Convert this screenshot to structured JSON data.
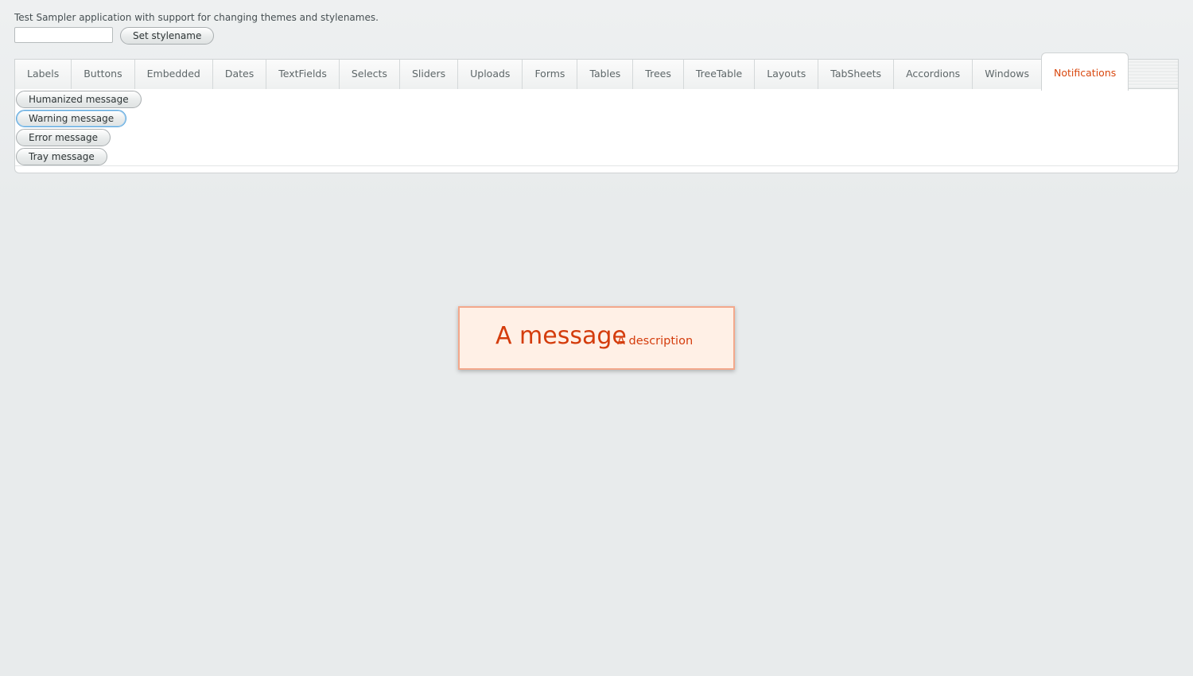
{
  "app": {
    "intro_text": "Test Sampler application with support for changing themes and stylenames.",
    "stylename_input_value": "",
    "set_stylename_label": "Set stylename"
  },
  "tabs": [
    {
      "label": "Labels",
      "selected": false
    },
    {
      "label": "Buttons",
      "selected": false
    },
    {
      "label": "Embedded",
      "selected": false
    },
    {
      "label": "Dates",
      "selected": false
    },
    {
      "label": "TextFields",
      "selected": false
    },
    {
      "label": "Selects",
      "selected": false
    },
    {
      "label": "Sliders",
      "selected": false
    },
    {
      "label": "Uploads",
      "selected": false
    },
    {
      "label": "Forms",
      "selected": false
    },
    {
      "label": "Tables",
      "selected": false
    },
    {
      "label": "Trees",
      "selected": false
    },
    {
      "label": "TreeTable",
      "selected": false
    },
    {
      "label": "Layouts",
      "selected": false
    },
    {
      "label": "TabSheets",
      "selected": false
    },
    {
      "label": "Accordions",
      "selected": false
    },
    {
      "label": "Windows",
      "selected": false
    },
    {
      "label": "Notifications",
      "selected": true
    }
  ],
  "notifications_tab": {
    "buttons": [
      {
        "label": "Humanized message",
        "focused": false
      },
      {
        "label": "Warning message",
        "focused": true
      },
      {
        "label": "Error message",
        "focused": false
      },
      {
        "label": "Tray message",
        "focused": false
      }
    ]
  },
  "notification": {
    "caption": "A message",
    "description": "A description"
  },
  "colors": {
    "accent": "#d9480f",
    "notification_bg": "#fff0e6",
    "notification_border": "#f3a88c",
    "focus": "#5ba6dc"
  }
}
